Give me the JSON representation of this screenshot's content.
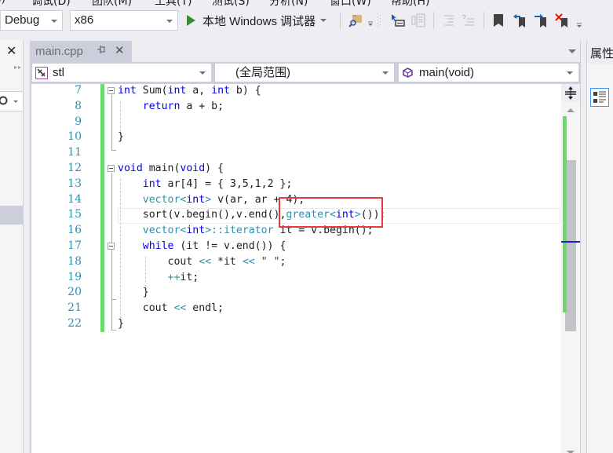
{
  "menu": {
    "items": [
      "B)",
      "调试(D)",
      "团队(M)",
      "工具(T)",
      "测试(S)",
      "分析(N)",
      "窗口(W)",
      "帮助(H)"
    ]
  },
  "toolbar": {
    "config_value": "Debug",
    "platform_value": "x86",
    "run_label": "本地 Windows 调试器",
    "icons": [
      "find-in-files-icon",
      "toolbar-overflow-icon",
      "step-into-icon",
      "comment-out-icon",
      "indent-icon",
      "outdent-icon",
      "bookmark-icon",
      "previous-bookmark-icon",
      "next-bookmark-icon",
      "clear-bookmarks-icon",
      "toolbar-options-icon"
    ]
  },
  "left_panel": {
    "close_label": "✕",
    "search_icon": "search-icon"
  },
  "document_tab": {
    "filename": "main.cpp",
    "pin_label": "⊣",
    "close_label": "✕"
  },
  "navigation": {
    "project": "stl",
    "scope": "(全局范围)",
    "member": "main(void)"
  },
  "editor": {
    "line_numbers": [
      "7",
      "8",
      "9",
      "10",
      "11",
      "12",
      "13",
      "14",
      "15",
      "16",
      "17",
      "18",
      "19",
      "20",
      "21",
      "22"
    ],
    "highlighted_text": ",greater<int>()",
    "lines": [
      [
        {
          "t": "int",
          "c": "kw"
        },
        {
          "t": " Sum(",
          "c": "fn"
        },
        {
          "t": "int",
          "c": "kw"
        },
        {
          "t": " a, ",
          "c": "fn"
        },
        {
          "t": "int",
          "c": "kw"
        },
        {
          "t": " b) {",
          "c": "fn"
        }
      ],
      [
        {
          "t": "    ",
          "c": "fn"
        },
        {
          "t": "return",
          "c": "kw"
        },
        {
          "t": " a + b;",
          "c": "fn"
        }
      ],
      [],
      [
        {
          "t": "}",
          "c": "fn"
        }
      ],
      [],
      [
        {
          "t": "void",
          "c": "kw"
        },
        {
          "t": " main(",
          "c": "fn"
        },
        {
          "t": "void",
          "c": "kw"
        },
        {
          "t": ") {",
          "c": "fn"
        }
      ],
      [
        {
          "t": "    ",
          "c": "fn"
        },
        {
          "t": "int",
          "c": "kw"
        },
        {
          "t": " ar[4] = { 3,5,1,2 };",
          "c": "fn"
        }
      ],
      [
        {
          "t": "    ",
          "c": "fn"
        },
        {
          "t": "vector",
          "c": "ty"
        },
        {
          "t": "<",
          "c": "ty"
        },
        {
          "t": "int",
          "c": "kw"
        },
        {
          "t": ">",
          "c": "ty"
        },
        {
          "t": " v(ar, ar + 4);",
          "c": "fn"
        }
      ],
      [
        {
          "t": "    sort(v.begin(),v.end()",
          "c": "fn"
        },
        {
          "t": ",",
          "c": "fn"
        },
        {
          "t": "greater",
          "c": "ty"
        },
        {
          "t": "<",
          "c": "ty"
        },
        {
          "t": "int",
          "c": "kw"
        },
        {
          "t": ">",
          "c": "ty"
        },
        {
          "t": "());",
          "c": "fn"
        }
      ],
      [
        {
          "t": "    ",
          "c": "fn"
        },
        {
          "t": "vector",
          "c": "ty"
        },
        {
          "t": "<",
          "c": "ty"
        },
        {
          "t": "int",
          "c": "kw"
        },
        {
          "t": ">::",
          "c": "ty"
        },
        {
          "t": "iterator",
          "c": "ty"
        },
        {
          "t": " it = v.begin();",
          "c": "fn"
        }
      ],
      [
        {
          "t": "    ",
          "c": "fn"
        },
        {
          "t": "while",
          "c": "kw"
        },
        {
          "t": " (it != v.end()) {",
          "c": "fn"
        }
      ],
      [
        {
          "t": "        cout ",
          "c": "fn"
        },
        {
          "t": "<<",
          "c": "ty"
        },
        {
          "t": " *it ",
          "c": "fn"
        },
        {
          "t": "<<",
          "c": "ty"
        },
        {
          "t": " ",
          "c": "fn"
        },
        {
          "t": "\" \"",
          "c": "str"
        },
        {
          "t": ";",
          "c": "fn"
        }
      ],
      [
        {
          "t": "        ",
          "c": "fn"
        },
        {
          "t": "++",
          "c": "ty"
        },
        {
          "t": "it;",
          "c": "fn"
        }
      ],
      [
        {
          "t": "    }",
          "c": "fn"
        }
      ],
      [
        {
          "t": "    cout ",
          "c": "fn"
        },
        {
          "t": "<<",
          "c": "ty"
        },
        {
          "t": " endl;",
          "c": "fn"
        }
      ],
      [
        {
          "t": "}",
          "c": "fn"
        }
      ]
    ]
  },
  "right_panel": {
    "title": "属性"
  },
  "colors": {
    "change_bar": "#6ada6a",
    "highlight_border": "#e83a3a",
    "keyword": "#0000ff",
    "type": "#2b91af",
    "caret_marker": "#1e1ec8"
  }
}
